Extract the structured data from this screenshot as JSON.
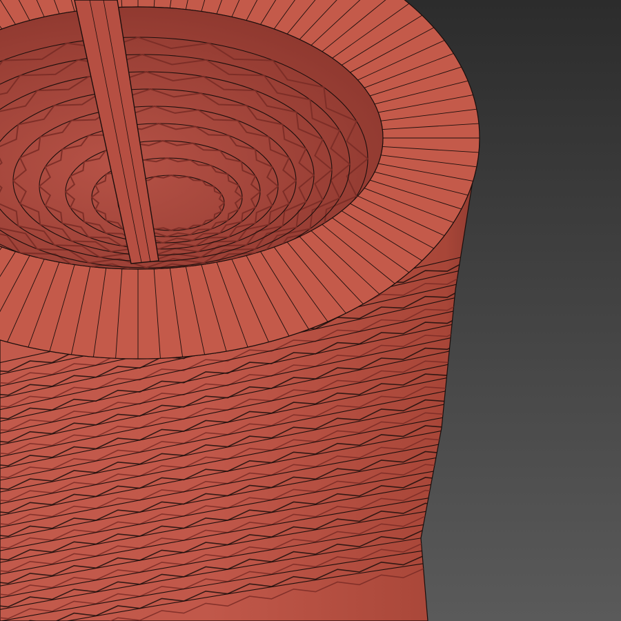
{
  "viewport": {
    "background_top": "#2c2c2c",
    "background_bottom": "#5a5a5a"
  },
  "model": {
    "shell_color": "#c1584a",
    "shell_shadow": "#7a2c26",
    "shell_highlight": "#cf6a5a",
    "wireframe_color": "#1a0e0c",
    "lid_ring_color": "#c45a4a",
    "shaft_color": "#b64f42"
  }
}
